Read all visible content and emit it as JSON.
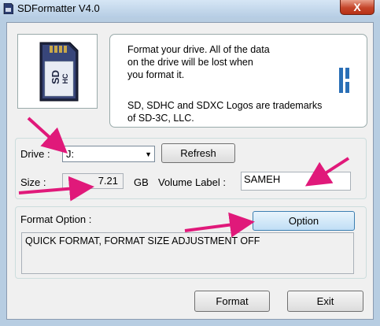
{
  "window": {
    "title": "SDFormatter V4.0",
    "close_glyph": "X"
  },
  "info": {
    "warning": "Format your drive. All of the data\non the drive will be lost when\nyou format it.",
    "trademark": "SD, SDHC and SDXC Logos are trademarks\nof SD-3C, LLC."
  },
  "drive": {
    "label": "Drive :",
    "selected": "J:",
    "refresh_label": "Refresh"
  },
  "size": {
    "label": "Size :",
    "value": "7.21",
    "unit": "GB"
  },
  "volume": {
    "label": "Volume Label :",
    "value": "SAMEH"
  },
  "format_option": {
    "label": "Format Option :",
    "option_button": "Option",
    "status": "QUICK FORMAT, FORMAT SIZE ADJUSTMENT OFF"
  },
  "actions": {
    "format_label": "Format",
    "exit_label": "Exit"
  },
  "colors": {
    "annotation_arrow": "#e0197a",
    "sd_blue": "#2a5fa8"
  }
}
